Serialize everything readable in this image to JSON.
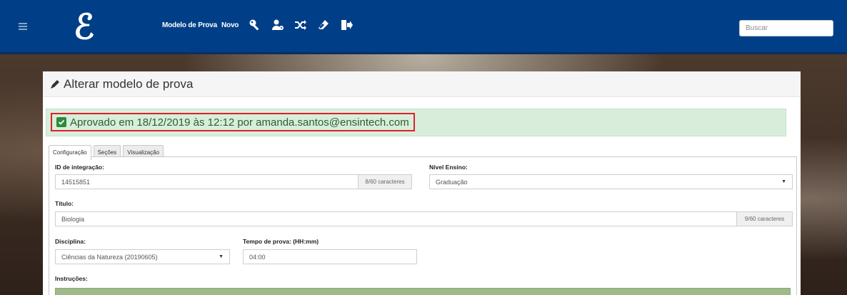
{
  "nav": {
    "logo": "ℰ",
    "links": [
      "Modelo de Prova",
      "Novo"
    ],
    "search_placeholder": "Buscar"
  },
  "panel": {
    "title": "Alterar modelo de prova",
    "alert": "Aprovado em 18/12/2019 às 12:12 por amanda.santos@ensintech.com"
  },
  "tabs": [
    "Configuração",
    "Seções",
    "Visualização"
  ],
  "form": {
    "id_label": "ID de integração:",
    "id_value": "14515851",
    "id_counter": "8/60 caracteres",
    "nivel_label": "Nível Ensino:",
    "nivel_value": "Graduação",
    "titulo_label": "Título:",
    "titulo_value": "Biologia",
    "titulo_counter": "9/60 caracteres",
    "disciplina_label": "Disciplina:",
    "disciplina_value": "Ciências da Natureza (20190605)",
    "tempo_label": "Tempo de prova: (HH:mm)",
    "tempo_value": "04:00",
    "instrucoes_label": "Instruções:"
  },
  "colors": {
    "navbar": "#003f87",
    "alert_bg": "#d8eedb",
    "alert_highlight": "#e0202a"
  }
}
